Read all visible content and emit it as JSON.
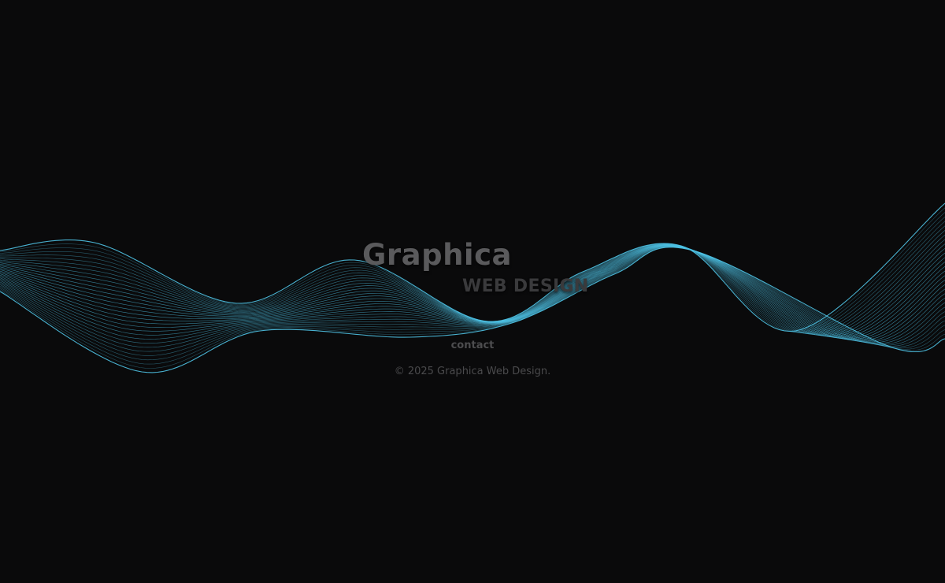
{
  "brand": {
    "name": "Graphica",
    "tagline": "WEB DESIGN"
  },
  "nav": {
    "contact_label": "contact"
  },
  "footer": {
    "copyright": "© 2025 Graphica Web Design."
  },
  "colors": {
    "background": "#0a0a0b",
    "wave_stroke": "#4fc3e6",
    "brand_text": "#5a5a5c",
    "tagline_text": "#3a3a3c",
    "muted_text": "#4a4a4c"
  }
}
